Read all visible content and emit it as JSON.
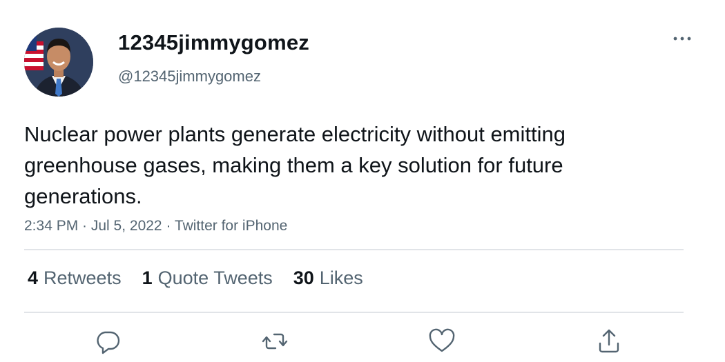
{
  "user": {
    "display_name": "12345jimmygomez",
    "handle": "@12345jimmygomez"
  },
  "tweet": {
    "text": "Nuclear power plants generate electricity without emitting greenhouse gases, making them a key solution for future generations.",
    "meta": "2:34 PM · Jul 5, 2022 · Twitter for iPhone"
  },
  "stats": {
    "retweets_count": "4",
    "retweets_label": "Retweets",
    "quotes_count": "1",
    "quotes_label": "Quote Tweets",
    "likes_count": "30",
    "likes_label": "Likes"
  },
  "actions": {
    "reply_icon": "reply-icon",
    "retweet_icon": "retweet-icon",
    "like_icon": "heart-icon",
    "share_icon": "share-icon"
  },
  "colors": {
    "text_primary": "#0f1419",
    "text_secondary": "#536471",
    "divider": "#e1e4e8"
  }
}
